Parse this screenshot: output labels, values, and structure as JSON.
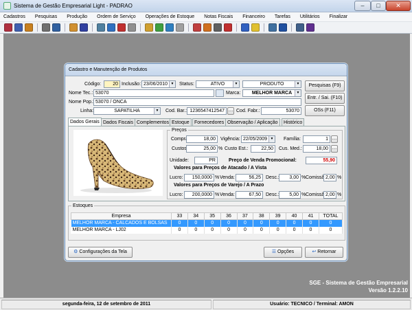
{
  "window": {
    "title": "Sistema de Gestão Empresarial Light - PADRAO",
    "min": "–",
    "max": "□",
    "close": "✕"
  },
  "menu": [
    "Cadastros",
    "Pesquisas",
    "Produção",
    "Ordem de Serviço",
    "Operações de Estoque",
    "Notas Fiscais",
    "Financeiro",
    "Tarefas",
    "Utilitários",
    "Finalizar"
  ],
  "toolbar": [
    {
      "icon": "report-icon",
      "color": "#b03040"
    },
    {
      "icon": "people-icon",
      "color": "#4060b0"
    },
    {
      "icon": "box-icon",
      "color": "#c88020"
    },
    {
      "icon": "glasses-icon",
      "color": "#707070"
    },
    {
      "icon": "book-icon",
      "color": "#3060a0"
    },
    {
      "icon": "cube-icon",
      "color": "#d09030"
    },
    {
      "icon": "pen-icon",
      "color": "#3040a0"
    },
    {
      "icon": "screen-icon",
      "color": "#5080a0"
    },
    {
      "icon": "cube-blue-icon",
      "color": "#3070c0"
    },
    {
      "icon": "tag-icon",
      "color": "#c03030"
    },
    {
      "icon": "document-icon",
      "color": "#909090"
    },
    {
      "icon": "folder-icon",
      "color": "#d0a030"
    },
    {
      "icon": "money-icon",
      "color": "#40a040"
    },
    {
      "icon": "globe-icon",
      "color": "#3080c0"
    },
    {
      "icon": "notes-icon",
      "color": "#a0a0a0"
    },
    {
      "icon": "truck-icon",
      "color": "#c04040"
    },
    {
      "icon": "cash-icon",
      "color": "#d07020"
    },
    {
      "icon": "calculator-icon",
      "color": "#606060"
    },
    {
      "icon": "chart-icon",
      "color": "#c03030"
    },
    {
      "icon": "calendar-icon",
      "color": "#3060c0"
    },
    {
      "icon": "note-icon",
      "color": "#e0c030"
    },
    {
      "icon": "computer-icon",
      "color": "#4070a0"
    },
    {
      "icon": "shield-icon",
      "color": "#2050a0"
    },
    {
      "icon": "users-icon",
      "color": "#40608a"
    },
    {
      "icon": "exit-icon",
      "color": "#603090"
    }
  ],
  "dialog": {
    "title": "Cadastro e Manutenção de Produtos",
    "codigo_label": "Código:",
    "codigo": "20",
    "inclusao_label": "Inclusão:",
    "inclusao": "23/06/2010",
    "status_label": "Status:",
    "status": "ATIVO",
    "tipo": "PRODUTO",
    "nome_tec_label": "Nome Tec.:",
    "nome_tec": "53070",
    "marca_label": "Marca:",
    "marca": "MELHOR MARCA",
    "nome_pop_label": "Nome Pop.:",
    "nome_pop": "53070 / ONCA",
    "linha_label": "Linha:",
    "linha": "SAPATILHA",
    "cod_bar_label": "Cod. Bar.:",
    "cod_bar": "1236547412547",
    "cod_fabr_label": "Cod. Fabr.:",
    "cod_fabr": "53070",
    "buttons": {
      "pesquisas": "Pesquisas (F9)",
      "entr_sai": "Entr. / Sai. (F10)",
      "oss": "OSs (F11)"
    },
    "tabs": [
      "Dados Gerais",
      "Dados Fiscais",
      "Complementos",
      "Estoque",
      "Fornecedores",
      "Observação / Aplicação",
      "Histórico"
    ],
    "precos": {
      "legend": "Preços",
      "compra_label": "Compra:",
      "compra": "18,00",
      "vigencia_label": "Vigência:",
      "vigencia": "22/05/2009",
      "familia_label": "Família:",
      "familia": "1",
      "custos_label": "Custos:",
      "custos": "25,00",
      "custos_unit": "%",
      "custo_est_label": "Custo Est.:",
      "custo_est": "22,50",
      "cus_med_label": "Cus. Med.:",
      "cus_med": "18,00",
      "unidade_label": "Unidade:",
      "unidade": "PR",
      "promo_label": "Preço de Venda Promocional:",
      "promo": "55,90",
      "atacado_title": "Valores para Preços de Atacado / A Vista",
      "varejo_title": "Valores para Preços de Varejo / A Prazo",
      "lucro_label": "Lucro:",
      "venda_label": "Venda:",
      "desc_label": "Desc.:",
      "comissao_label": "Comissão:",
      "pct": "%",
      "atacado": {
        "lucro": "150,0000",
        "venda": "56,25",
        "desc": "3,00",
        "comissao": "2,00"
      },
      "varejo": {
        "lucro": "200,0000",
        "venda": "67,50",
        "desc": "5,00",
        "comissao": "2,00"
      }
    },
    "estoques": {
      "legend": "Estoques",
      "columns": [
        "Empresa",
        "33",
        "34",
        "35",
        "36",
        "37",
        "38",
        "39",
        "40",
        "41",
        "TOTAL"
      ],
      "rows": [
        [
          "MELHOR MARCA - CALCADOS E BOLSAS",
          "0",
          "0",
          "0",
          "0",
          "0",
          "0",
          "0",
          "0",
          "0",
          "0"
        ],
        [
          "MELHOR MARCA - LJ02",
          "0",
          "0",
          "0",
          "0",
          "0",
          "0",
          "0",
          "0",
          "0",
          "0"
        ]
      ]
    },
    "config_button": "Configurações da Tela",
    "opcoes_button": "Opções",
    "retornar_button": "Retornar"
  },
  "brand": {
    "line1": "SGE - Sistema de Gestão Empresarial",
    "line2": "Versão 1.2.2.10"
  },
  "status": {
    "date": "segunda-feira, 12 de setembro de 2011",
    "user": "Usuário: TECNICO / Terminal: AMON"
  }
}
